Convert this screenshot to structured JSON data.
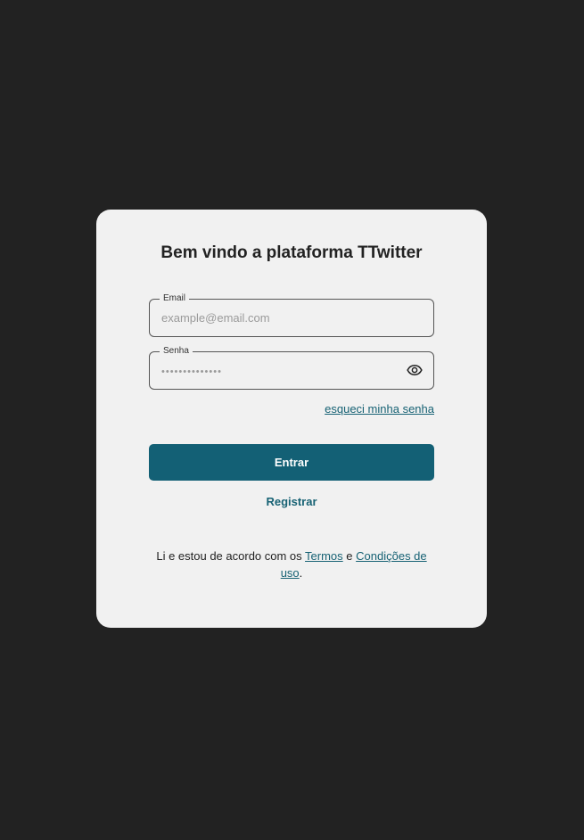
{
  "page": {
    "background": "#222222",
    "card_background": "#f1f1f1",
    "accent": "#136075"
  },
  "login": {
    "title": "Bem vindo a plataforma TTwitter",
    "email": {
      "label": "Email",
      "placeholder": "example@email.com",
      "value": ""
    },
    "password": {
      "label": "Senha",
      "placeholder": "••••••••••••••",
      "value": "",
      "toggle_icon": "eye-icon"
    },
    "forgot_label": "esqueci minha senha",
    "submit_label": "Entrar",
    "register_label": "Registrar",
    "terms": {
      "prefix": "Li e estou de acordo com os ",
      "link1": "Termos",
      "middle": " e ",
      "link2": "Condições de uso",
      "suffix": "."
    }
  }
}
